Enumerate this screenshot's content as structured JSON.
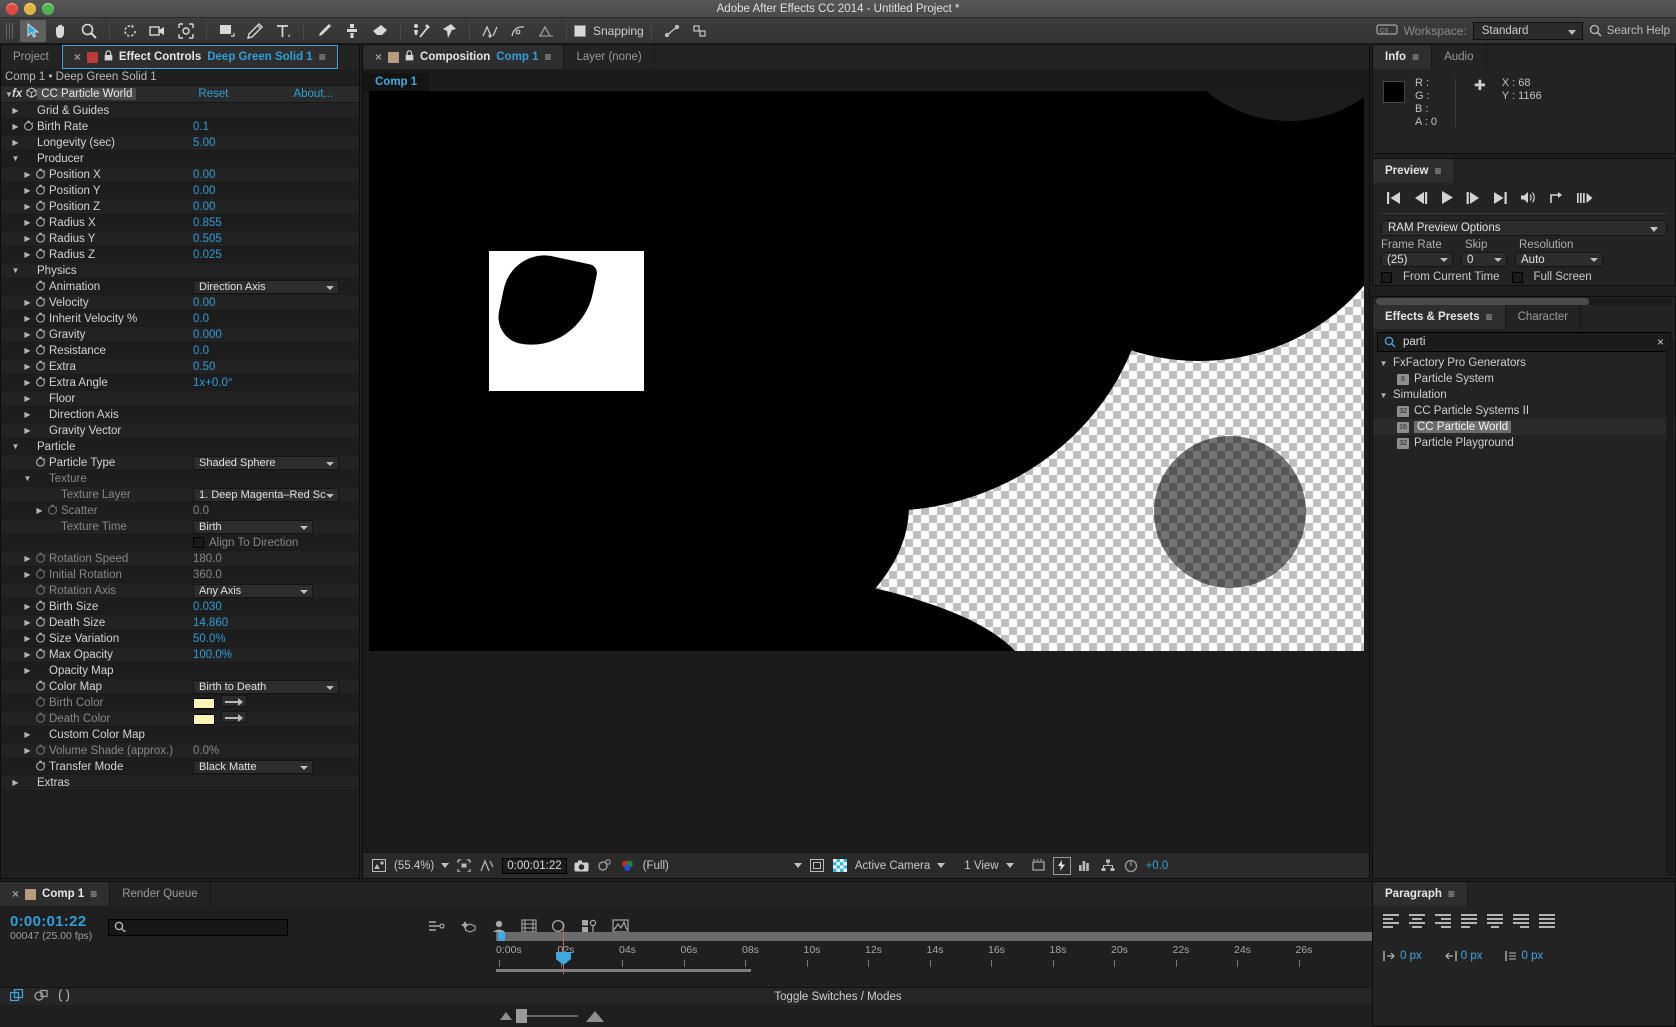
{
  "window": {
    "title": "Adobe After Effects CC 2014 - Untitled Project *"
  },
  "toolbar": {
    "snapping_label": "Snapping",
    "workspace_label": "Workspace:",
    "workspace_value": "Standard",
    "search_help": "Search Help",
    "tools": [
      "selection-tool",
      "hand-tool",
      "zoom-tool",
      "rotation-tool",
      "camera-tool",
      "pan-behind-tool",
      "shape-tool",
      "pen-tool",
      "type-tool",
      "brush-tool",
      "clone-stamp-tool",
      "eraser-tool",
      "roto-brush-tool",
      "puppet-pin-tool"
    ],
    "right_tools": [
      "anchor-align-tool",
      "mask-tool",
      "grid-toggle"
    ]
  },
  "effect_controls": {
    "tabs": [
      {
        "label": "Project",
        "selected": false
      },
      {
        "label": "Effect Controls",
        "sublabel": "Deep Green Solid 1",
        "selected": true
      }
    ],
    "breadcrumb": "Comp 1 • Deep Green Solid 1",
    "effect_name": "CC Particle World",
    "reset": "Reset",
    "about": "About...",
    "rows": [
      {
        "indent": 0,
        "tri": "right",
        "stopwatch": false,
        "label": "Grid & Guides",
        "value": "",
        "type": "group",
        "dim": false
      },
      {
        "indent": 0,
        "tri": "right",
        "stopwatch": true,
        "label": "Birth Rate",
        "value": "0.1",
        "type": "number",
        "dim": false
      },
      {
        "indent": 0,
        "tri": "right",
        "stopwatch": false,
        "label": "Longevity (sec)",
        "value": "5.00",
        "type": "number",
        "dim": false
      },
      {
        "indent": 0,
        "tri": "down",
        "stopwatch": false,
        "label": "Producer",
        "value": "",
        "type": "group",
        "dim": false
      },
      {
        "indent": 1,
        "tri": "right",
        "stopwatch": true,
        "label": "Position X",
        "value": "0.00",
        "type": "number",
        "dim": false
      },
      {
        "indent": 1,
        "tri": "right",
        "stopwatch": true,
        "label": "Position Y",
        "value": "0.00",
        "type": "number",
        "dim": false
      },
      {
        "indent": 1,
        "tri": "right",
        "stopwatch": true,
        "label": "Position Z",
        "value": "0.00",
        "type": "number",
        "dim": false
      },
      {
        "indent": 1,
        "tri": "right",
        "stopwatch": true,
        "label": "Radius X",
        "value": "0.855",
        "type": "number",
        "dim": false
      },
      {
        "indent": 1,
        "tri": "right",
        "stopwatch": true,
        "label": "Radius Y",
        "value": "0.505",
        "type": "number",
        "dim": false
      },
      {
        "indent": 1,
        "tri": "right",
        "stopwatch": true,
        "label": "Radius Z",
        "value": "0.025",
        "type": "number",
        "dim": false
      },
      {
        "indent": 0,
        "tri": "down",
        "stopwatch": false,
        "label": "Physics",
        "value": "",
        "type": "group",
        "dim": false
      },
      {
        "indent": 1,
        "tri": "none",
        "stopwatch": true,
        "label": "Animation",
        "value": "Direction Axis",
        "type": "dropdown",
        "dim": false
      },
      {
        "indent": 1,
        "tri": "right",
        "stopwatch": true,
        "label": "Velocity",
        "value": "0.00",
        "type": "number",
        "dim": false
      },
      {
        "indent": 1,
        "tri": "right",
        "stopwatch": true,
        "label": "Inherit Velocity %",
        "value": "0.0",
        "type": "number",
        "dim": false
      },
      {
        "indent": 1,
        "tri": "right",
        "stopwatch": true,
        "label": "Gravity",
        "value": "0.000",
        "type": "number",
        "dim": false
      },
      {
        "indent": 1,
        "tri": "right",
        "stopwatch": true,
        "label": "Resistance",
        "value": "0.0",
        "type": "number",
        "dim": false
      },
      {
        "indent": 1,
        "tri": "right",
        "stopwatch": true,
        "label": "Extra",
        "value": "0.50",
        "type": "number",
        "dim": false
      },
      {
        "indent": 1,
        "tri": "right",
        "stopwatch": true,
        "label": "Extra Angle",
        "value": "1x+0.0°",
        "type": "number",
        "dim": false
      },
      {
        "indent": 1,
        "tri": "right",
        "stopwatch": false,
        "label": "Floor",
        "value": "",
        "type": "group",
        "dim": false
      },
      {
        "indent": 1,
        "tri": "right",
        "stopwatch": false,
        "label": "Direction Axis",
        "value": "",
        "type": "group",
        "dim": false
      },
      {
        "indent": 1,
        "tri": "right",
        "stopwatch": false,
        "label": "Gravity Vector",
        "value": "",
        "type": "group",
        "dim": false
      },
      {
        "indent": 0,
        "tri": "down",
        "stopwatch": false,
        "label": "Particle",
        "value": "",
        "type": "group",
        "dim": false
      },
      {
        "indent": 1,
        "tri": "none",
        "stopwatch": true,
        "label": "Particle Type",
        "value": "Shaded Sphere",
        "type": "dropdown",
        "dim": false
      },
      {
        "indent": 1,
        "tri": "down",
        "stopwatch": false,
        "label": "Texture",
        "value": "",
        "type": "group",
        "dim": true
      },
      {
        "indent": 2,
        "tri": "none",
        "stopwatch": false,
        "label": "Texture Layer",
        "value": "1. Deep Magenta–Red Sc",
        "type": "dropdown-wide",
        "dim": true
      },
      {
        "indent": 2,
        "tri": "right",
        "stopwatch": true,
        "label": "Scatter",
        "value": "0.0",
        "type": "number-dim",
        "dim": true
      },
      {
        "indent": 2,
        "tri": "none",
        "stopwatch": false,
        "label": "Texture Time",
        "value": "Birth",
        "type": "dropdown-med",
        "dim": true
      },
      {
        "indent": 2,
        "tri": "none",
        "stopwatch": false,
        "label": "",
        "value": "Align To Direction",
        "type": "checkbox",
        "dim": true
      },
      {
        "indent": 1,
        "tri": "right",
        "stopwatch": true,
        "label": "Rotation Speed",
        "value": "180.0",
        "type": "number-dim",
        "dim": true
      },
      {
        "indent": 1,
        "tri": "right",
        "stopwatch": true,
        "label": "Initial Rotation",
        "value": "360.0",
        "type": "number-dim",
        "dim": true
      },
      {
        "indent": 1,
        "tri": "none",
        "stopwatch": true,
        "label": "Rotation Axis",
        "value": "Any Axis",
        "type": "dropdown-med",
        "dim": true
      },
      {
        "indent": 1,
        "tri": "right",
        "stopwatch": true,
        "label": "Birth Size",
        "value": "0.030",
        "type": "number",
        "dim": false
      },
      {
        "indent": 1,
        "tri": "right",
        "stopwatch": true,
        "label": "Death Size",
        "value": "14.860",
        "type": "number",
        "dim": false
      },
      {
        "indent": 1,
        "tri": "right",
        "stopwatch": true,
        "label": "Size Variation",
        "value": "50.0%",
        "type": "number",
        "dim": false
      },
      {
        "indent": 1,
        "tri": "right",
        "stopwatch": true,
        "label": "Max Opacity",
        "value": "100.0%",
        "type": "number",
        "dim": false
      },
      {
        "indent": 1,
        "tri": "right",
        "stopwatch": false,
        "label": "Opacity Map",
        "value": "",
        "type": "group",
        "dim": false
      },
      {
        "indent": 1,
        "tri": "none",
        "stopwatch": true,
        "label": "Color Map",
        "value": "Birth to Death",
        "type": "dropdown",
        "dim": false
      },
      {
        "indent": 1,
        "tri": "none",
        "stopwatch": true,
        "label": "Birth Color",
        "value": "#FAF5B4",
        "type": "color",
        "dim": true
      },
      {
        "indent": 1,
        "tri": "none",
        "stopwatch": true,
        "label": "Death Color",
        "value": "#FAF5B4",
        "type": "color",
        "dim": true
      },
      {
        "indent": 1,
        "tri": "right",
        "stopwatch": false,
        "label": "Custom Color Map",
        "value": "",
        "type": "group",
        "dim": false
      },
      {
        "indent": 1,
        "tri": "right",
        "stopwatch": true,
        "label": "Volume Shade (approx.)",
        "value": "0.0%",
        "type": "number-dim",
        "dim": true
      },
      {
        "indent": 1,
        "tri": "none",
        "stopwatch": true,
        "label": "Transfer Mode",
        "value": "Black Matte",
        "type": "dropdown-med",
        "dim": false
      },
      {
        "indent": 0,
        "tri": "right",
        "stopwatch": false,
        "label": "Extras",
        "value": "",
        "type": "group",
        "dim": false
      }
    ]
  },
  "composition": {
    "tabs": [
      {
        "label": "Composition",
        "sublabel": "Comp 1",
        "selected": true
      },
      {
        "label": "Layer (none)",
        "selected": false
      }
    ],
    "subtab": "Comp 1",
    "bottom_bar": {
      "magnification": "(55.4%)",
      "time": "0:00:01:22",
      "resolution": "(Full)",
      "camera": "Active Camera",
      "views": "1 View",
      "exposure": "+0.0",
      "icons": [
        "preview-toggle-icon",
        "region-of-interest-icon",
        "mask-guides-icon",
        "snapshot-icon",
        "show-snapshot-icon",
        "channel-icon",
        "transparency-grid-icon",
        "3d-renderer-icon",
        "timeline-icon",
        "fast-preview-icon",
        "histogram-icon",
        "renderer-options-icon",
        "exposure-reset-icon"
      ]
    }
  },
  "info": {
    "tabs": [
      {
        "label": "Info",
        "selected": true
      },
      {
        "label": "Audio",
        "selected": false
      }
    ],
    "r_label": "R :",
    "g_label": "G :",
    "b_label": "B :",
    "a_label": "A : 0",
    "x_label": "X : 68",
    "y_label": "Y : 1166"
  },
  "preview": {
    "tab": "Preview",
    "transport": [
      "first-frame-icon",
      "previous-frame-icon",
      "play-icon",
      "next-frame-icon",
      "last-frame-icon",
      "audio-icon",
      "loop-icon",
      "ram-preview-icon"
    ],
    "ram_preview_options": "RAM Preview Options",
    "frame_rate_label": "Frame Rate",
    "skip_label": "Skip",
    "resolution_label": "Resolution",
    "frame_rate_value": "(25)",
    "skip_value": "0",
    "resolution_value": "Auto",
    "from_current_time": "From Current Time",
    "full_screen": "Full Screen"
  },
  "effects_presets": {
    "tabs": [
      {
        "label": "Effects & Presets",
        "selected": true
      },
      {
        "label": "Character",
        "selected": false
      }
    ],
    "search_value": "parti",
    "items": [
      {
        "label": "FxFactory Pro Generators",
        "type": "group",
        "indent": 0,
        "selected": false
      },
      {
        "label": "Particle System",
        "type": "effect",
        "indent": 1,
        "badge": "8",
        "selected": false
      },
      {
        "label": "Simulation",
        "type": "group",
        "indent": 0,
        "selected": false
      },
      {
        "label": "CC Particle Systems II",
        "type": "effect",
        "indent": 1,
        "badge": "32",
        "selected": false
      },
      {
        "label": "CC Particle World",
        "type": "effect",
        "indent": 1,
        "badge": "16",
        "selected": true
      },
      {
        "label": "Particle Playground",
        "type": "effect",
        "indent": 1,
        "badge": "32",
        "selected": false
      }
    ]
  },
  "timeline": {
    "tabs": [
      {
        "label": "Comp 1",
        "selected": true
      },
      {
        "label": "Render Queue",
        "selected": false
      }
    ],
    "current_time": "0:00:01:22",
    "frame_info": "00047 (25.00 fps)",
    "toggle_switches": "Toggle Switches / Modes",
    "ruler_ticks": [
      "0:00s",
      "02s",
      "04s",
      "06s",
      "08s",
      "10s",
      "12s",
      "14s",
      "16s",
      "18s",
      "20s",
      "22s",
      "24s",
      "26s"
    ]
  },
  "paragraph": {
    "tab": "Paragraph",
    "indent_left": "0 px",
    "indent_right": "0 px",
    "indent_first": "0 px"
  },
  "colors": {
    "accent_blue": "#2f9fd8",
    "panel_bg": "#232323",
    "birth_color": "#FAF5B4",
    "death_color": "#FAF5B4"
  }
}
